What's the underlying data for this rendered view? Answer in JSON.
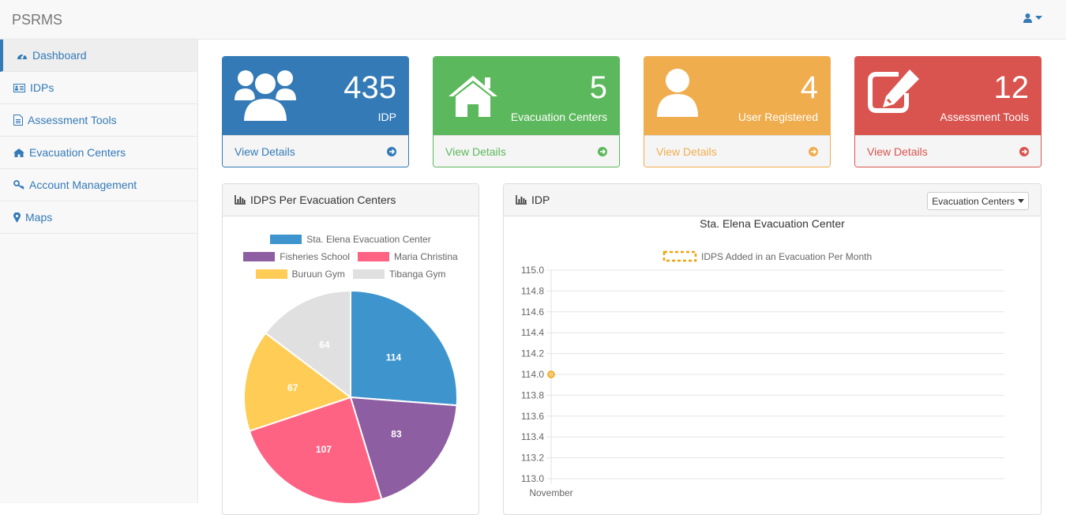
{
  "app": {
    "brand": "PSRMS"
  },
  "sidebar": {
    "items": [
      {
        "label": "Dashboard",
        "icon": "dashboard-icon"
      },
      {
        "label": "IDPs",
        "icon": "id-card-icon"
      },
      {
        "label": "Assessment Tools",
        "icon": "file-icon"
      },
      {
        "label": "Evacuation Centers",
        "icon": "home-icon"
      },
      {
        "label": "Account Management",
        "icon": "key-icon"
      },
      {
        "label": "Maps",
        "icon": "map-marker-icon"
      }
    ]
  },
  "stats": [
    {
      "value": "435",
      "label": "IDP",
      "link": "View Details",
      "color": "#337ab7",
      "icon": "users-icon"
    },
    {
      "value": "5",
      "label": "Evacuation Centers",
      "link": "View Details",
      "color": "#5cb85c",
      "icon": "home-icon"
    },
    {
      "value": "4",
      "label": "User Registered",
      "link": "View Details",
      "color": "#f0ad4e",
      "icon": "user-icon"
    },
    {
      "value": "12",
      "label": "Assessment Tools",
      "link": "View Details",
      "color": "#d9534f",
      "icon": "edit-icon"
    }
  ],
  "pie_panel": {
    "title": "IDPS Per Evacuation Centers"
  },
  "line_panel": {
    "title": "IDP",
    "dropdown": "Evacuation Centers"
  },
  "chart_data": [
    {
      "type": "pie",
      "categories": [
        "Sta. Elena Evacuation Center",
        "Fisheries School",
        "Maria Christina",
        "Buruun Gym",
        "Tibanga Gym"
      ],
      "values": [
        114,
        83,
        107,
        67,
        64
      ],
      "colors": [
        "#3e95cd",
        "#8e5ea2",
        "#ff6384",
        "#ffcd56",
        "#e0e0e0"
      ],
      "legend": "top"
    },
    {
      "type": "line",
      "title": "Sta. Elena Evacuation Center",
      "categories": [
        "November"
      ],
      "series": [
        {
          "name": "IDPS Added in an Evacuation Per Month",
          "values": [
            114
          ],
          "color": "#f0a30a"
        }
      ],
      "ylim": [
        113.0,
        115.0
      ],
      "yticks": [
        "115.0",
        "114.8",
        "114.6",
        "114.4",
        "114.2",
        "114.0",
        "113.8",
        "113.6",
        "113.4",
        "113.2",
        "113.0"
      ],
      "grid": true,
      "legend": "top"
    }
  ]
}
